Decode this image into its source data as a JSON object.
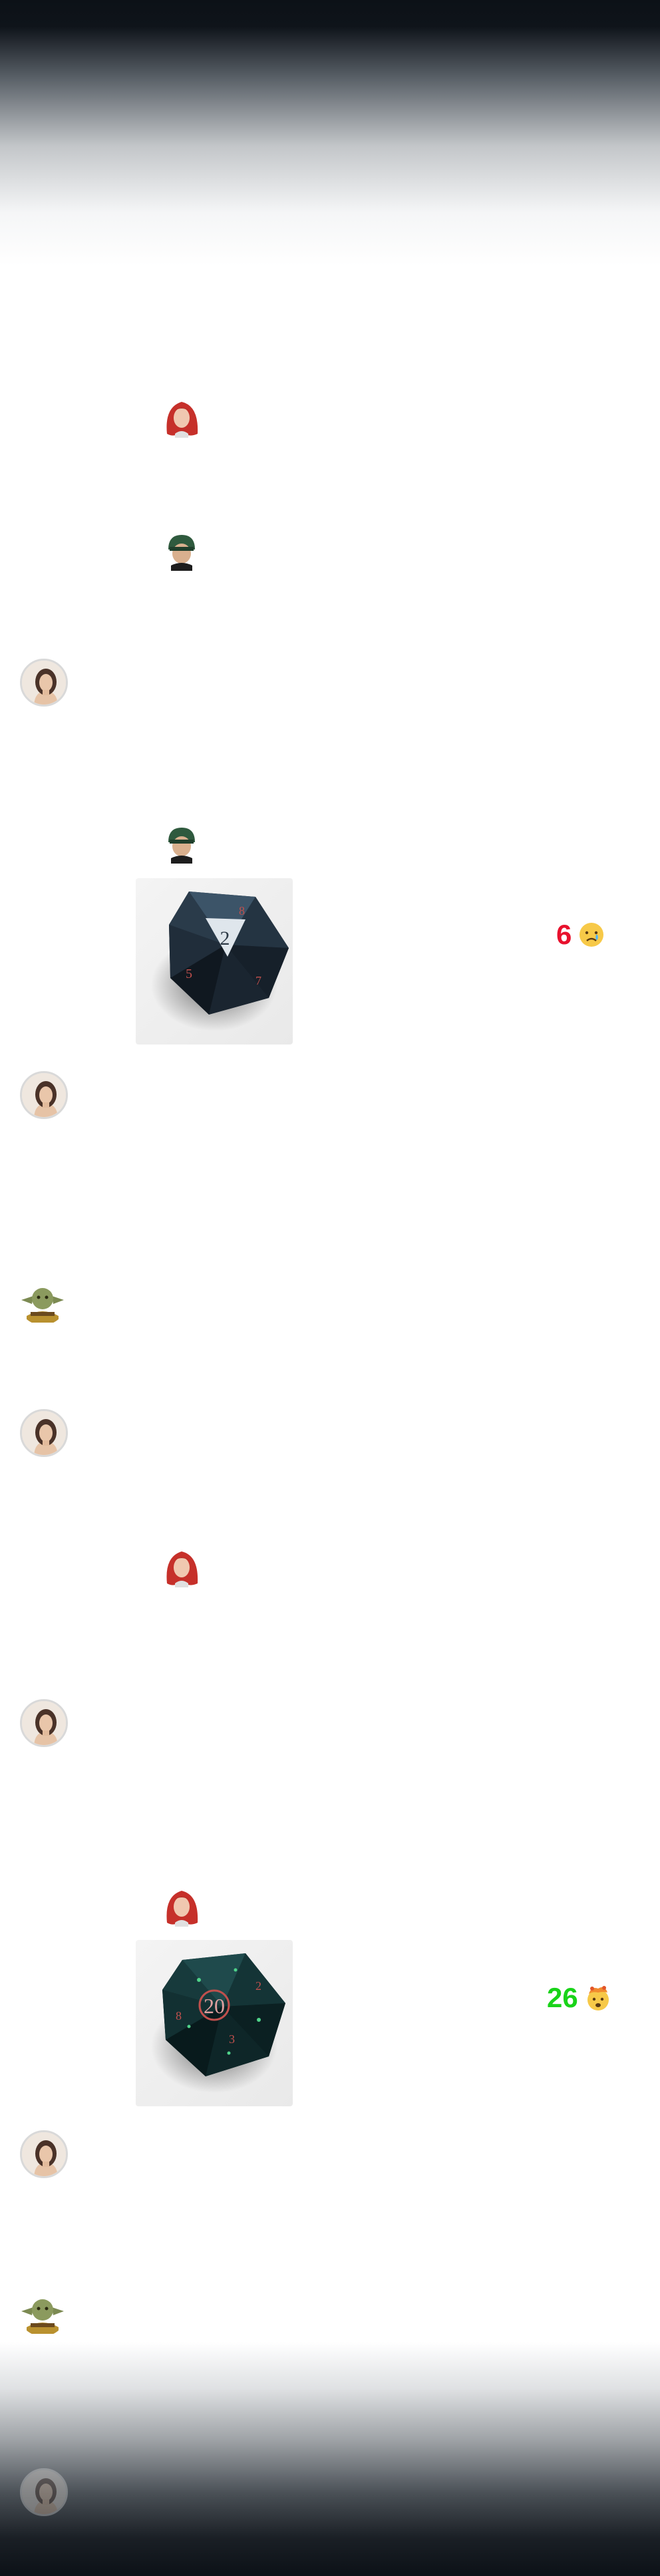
{
  "rolls": [
    {
      "value": "6",
      "color": "#e8112d",
      "emoji": "crying-face-icon"
    },
    {
      "value": "26",
      "color": "#19d319",
      "emoji": "exploding-head-icon"
    }
  ],
  "dice": [
    {
      "face": "2"
    },
    {
      "face": "20"
    }
  ]
}
